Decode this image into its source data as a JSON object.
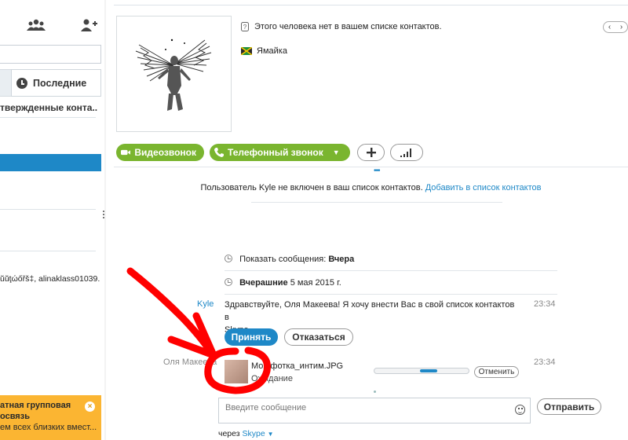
{
  "sidebar": {
    "recent_tab_label": "Последние",
    "heading": "твержденные конта...",
    "contact_text": "ŭŭţώőřš‡, alinaklass01039...",
    "promo": {
      "line1": "атная групповая",
      "line2": "освязь",
      "line3": "ем всех близких вмест..."
    }
  },
  "profile": {
    "not_in_contacts": "Этого человека нет в вашем списке контактов.",
    "country": "Ямайка"
  },
  "toolbar": {
    "video_call": "Видеозвонок",
    "phone_call": "Телефонный звонок"
  },
  "conversation": {
    "notice_text": "Пользователь Kyle не включен в ваш список контактов.",
    "notice_link": "Добавить в список контактов",
    "show_messages_label": "Показать сообщения:",
    "show_messages_value": "Вчера",
    "date_label": "Вчерашние",
    "date_value": "5 мая 2015 г.",
    "messages": [
      {
        "sender": "Kyle",
        "time": "23:34",
        "text_line1": "Здравствуйте, Оля Макеева! Я хочу внести Вас в свой список контактов в",
        "text_line2": "Skype."
      }
    ],
    "accept_label": "Принять",
    "decline_label": "Отказаться",
    "file_transfer": {
      "sender": "Оля Макеева",
      "time": "23:34",
      "file_name": "Моя фотка_интим.JPG",
      "status": "Ожидание",
      "progress": 0.67,
      "cancel_label": "Отменить"
    }
  },
  "composer": {
    "placeholder": "Введите сообщение",
    "send_label": "Отправить",
    "via_label": "через",
    "via_link": "Skype"
  },
  "colors": {
    "accent_blue": "#1e88c7",
    "call_green": "#7ab52f",
    "promo_orange": "#fbb532",
    "annotation_red": "#ff0000"
  }
}
